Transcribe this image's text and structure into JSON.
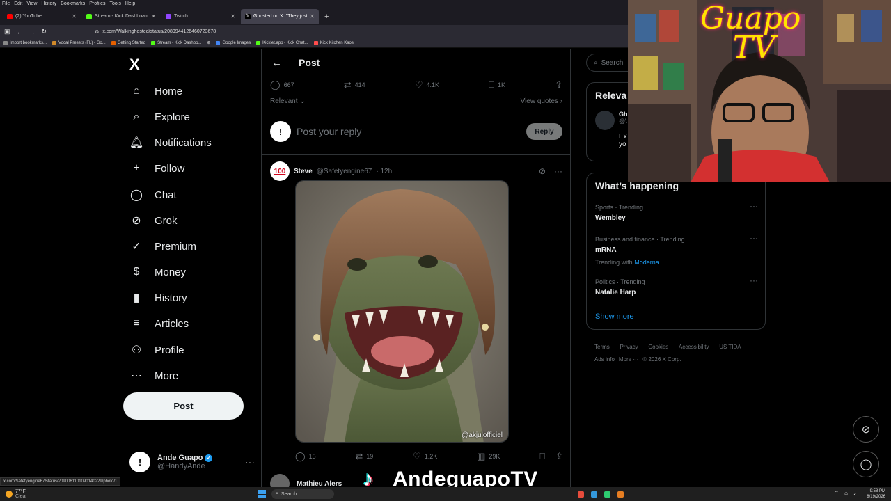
{
  "browser": {
    "menu": [
      "File",
      "Edit",
      "View",
      "History",
      "Bookmarks",
      "Profiles",
      "Tools",
      "Help"
    ],
    "tabs": [
      {
        "title": "(2) YouTube",
        "color": "#ff0000",
        "active": false
      },
      {
        "title": "Stream - Kick Dashboard",
        "color": "#53fc18",
        "active": false
      },
      {
        "title": "Twitch",
        "color": "#9146ff",
        "active": false
      },
      {
        "title": "Ghosted        on X: \"They just wo",
        "color": "#ffffff",
        "active": true
      }
    ],
    "url": "x.com/Walkinghosted/status/2089944126460723678",
    "bookmarks": [
      "Import bookmarks...",
      "Vocal Presets (FL) - Go...",
      "Getting Started",
      "Stream - Kick Dashbo...",
      "Google Images",
      "Kicklet.app - Kick Chat...",
      "Kick Kitchen Kaos"
    ]
  },
  "sidebar": {
    "logo": "X",
    "items": [
      {
        "label": "Home",
        "icon": "⌂"
      },
      {
        "label": "Explore",
        "icon": "⌕"
      },
      {
        "label": "Notifications",
        "icon": "♫"
      },
      {
        "label": "Follow",
        "icon": "+"
      },
      {
        "label": "Chat",
        "icon": "◯"
      },
      {
        "label": "Grok",
        "icon": "⊘"
      },
      {
        "label": "Premium",
        "icon": "✓"
      },
      {
        "label": "Money",
        "icon": "$"
      },
      {
        "label": "History",
        "icon": "▮"
      },
      {
        "label": "Articles",
        "icon": "≡"
      },
      {
        "label": "Profile",
        "icon": "⚇"
      },
      {
        "label": "More",
        "icon": "⋯"
      }
    ],
    "post_button": "Post",
    "account": {
      "name": "Ande Guapo",
      "handle": "@HandyAnde",
      "avatar": "!"
    }
  },
  "main": {
    "header_title": "Post",
    "stats": {
      "replies": "667",
      "reposts": "414",
      "likes": "4.1K",
      "bookmarks": "1K"
    },
    "filter_label": "Relevant",
    "view_quotes": "View quotes",
    "reply_placeholder": "Post your reply",
    "reply_button": "Reply",
    "tweet": {
      "avatar": "100",
      "name": "Steve",
      "handle": "@Safetyengine67",
      "time": "· 12h",
      "watermark": "@akjulofficiel",
      "stats": {
        "replies": "15",
        "reposts": "19",
        "likes": "1.2K",
        "views": "29K"
      }
    },
    "next_tweet_name": "Mathieu Alers"
  },
  "right": {
    "search_placeholder": "Search",
    "relevant_title": "Releva",
    "relevant_user_initial": "Gh",
    "relevant_user_handle": "@\\",
    "relevant_preview_1": "Ex",
    "relevant_preview_2": "yo",
    "happening_title": "What’s happening",
    "trends": [
      {
        "meta": "Sports · Trending",
        "name": "Wembley",
        "with": ""
      },
      {
        "meta": "Business and finance · Trending",
        "name": "mRNA",
        "with": "Trending with",
        "link": "Moderna"
      },
      {
        "meta": "Politics · Trending",
        "name": "Natalie Harp",
        "with": ""
      }
    ],
    "show_more": "Show more",
    "footer": [
      "Terms",
      "·",
      "Privacy",
      "·",
      "Cookies",
      "·",
      "Accessibility",
      "·",
      "US TIDA",
      "Ads info",
      "More ···",
      "© 2026 X Corp."
    ]
  },
  "webcam": {
    "title_line1": "Guapo",
    "title_line2": "TV"
  },
  "overlay": {
    "tiktok_glyph": "♪",
    "brand": "AndeguapoTV"
  },
  "statusbar": "x.com/Safetyengine67/status/2090061101090140229/photo/1",
  "taskbar": {
    "temp": "77°F",
    "condition": "Clear",
    "search": "Search",
    "time": "9:58 PM",
    "date": "8/19/2026"
  }
}
